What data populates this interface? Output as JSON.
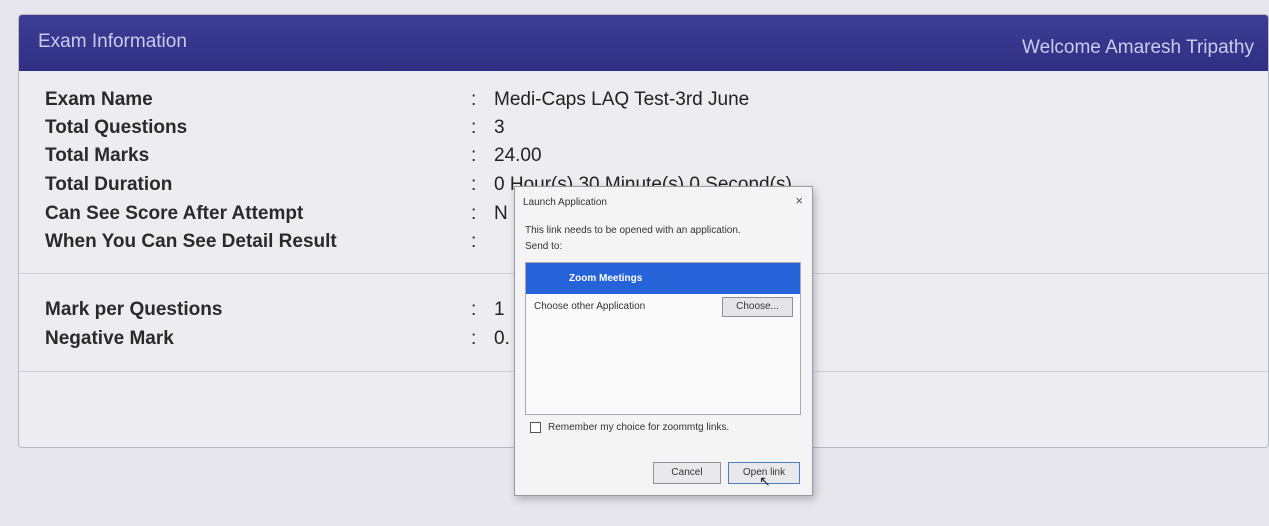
{
  "header": {
    "title": "Exam Information",
    "welcome": "Welcome Amaresh Tripathy"
  },
  "separator": ":",
  "fields": [
    {
      "label": "Exam Name",
      "value": "Medi-Caps LAQ Test-3rd June"
    },
    {
      "label": "Total Questions",
      "value": "3"
    },
    {
      "label": "Total Marks",
      "value": "24.00"
    },
    {
      "label": "Total Duration",
      "value": "0 Hour(s) 30 Minute(s) 0 Second(s)"
    },
    {
      "label": "Can See Score After Attempt",
      "value": "N"
    },
    {
      "label": "When You Can See Detail Result",
      "value": ""
    }
  ],
  "marking": [
    {
      "label": "Mark per Questions",
      "value": "1"
    },
    {
      "label": "Negative Mark",
      "value": "0."
    }
  ],
  "dialog": {
    "title": "Launch Application",
    "close": "×",
    "message": "This link needs to be opened with an application.",
    "send_to": "Send to:",
    "apps": [
      "Zoom Meetings"
    ],
    "other_app": "Choose other Application",
    "choose_button": "Choose...",
    "remember": "Remember my choice for zoommtg links.",
    "cancel": "Cancel",
    "open": "Open link",
    "cursor": "↖"
  }
}
